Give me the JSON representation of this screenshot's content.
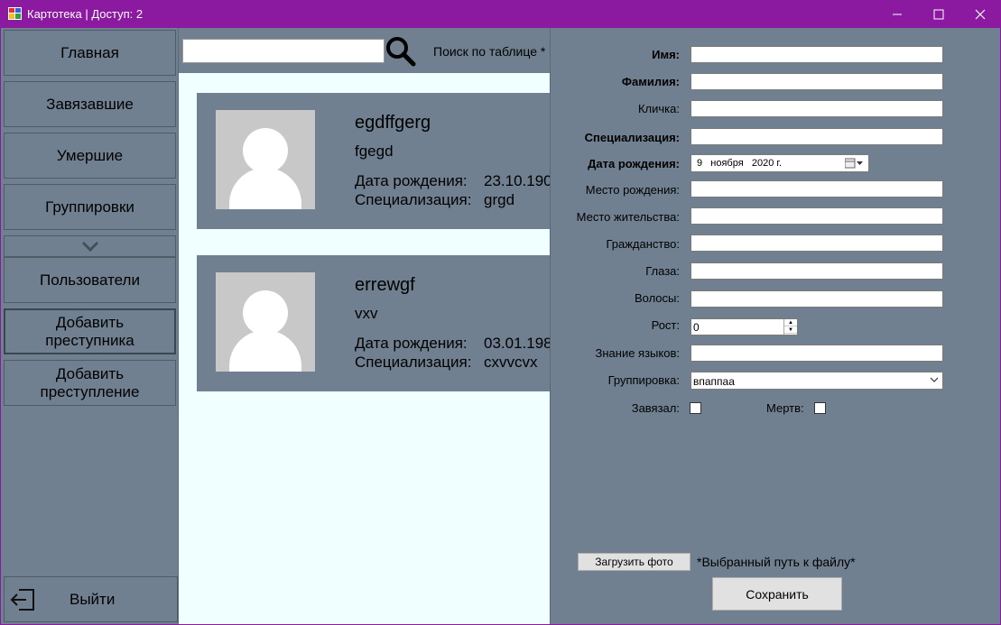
{
  "window": {
    "title": "Картотека | Доступ: 2",
    "icons": [
      "app-icon",
      "minimize-icon",
      "maximize-icon",
      "close-icon"
    ]
  },
  "sidebar": {
    "items": [
      {
        "label": "Главная"
      },
      {
        "label": "Завязавшие"
      },
      {
        "label": "Умершие"
      },
      {
        "label": "Группировки"
      },
      {
        "label": "Пользователи"
      },
      {
        "label": "Добавить\nпреступника"
      },
      {
        "label": "Добавить\nпреступление"
      }
    ],
    "exit_label": "Выйти"
  },
  "search": {
    "value": "",
    "hint": "Поиск по таблице *"
  },
  "cards": [
    {
      "name": "egdffgerg",
      "nickname": "fgegd",
      "birth_label": "Дата рождения:",
      "birth_value": "23.10.190",
      "spec_label": "Специализация:",
      "spec_value": "grgd"
    },
    {
      "name": "errewgf",
      "nickname": "vxv",
      "birth_label": "Дата рождения:",
      "birth_value": "03.01.198",
      "spec_label": "Специализация:",
      "spec_value": "cxvvcvx"
    }
  ],
  "form": {
    "fields": [
      {
        "label": "Имя:",
        "value": ""
      },
      {
        "label": "Фамилия:",
        "value": ""
      },
      {
        "label": "Кличка:",
        "value": ""
      },
      {
        "label": "Специализация:",
        "value": ""
      },
      {
        "label": "Дата рождения:",
        "value": "9   ноября   2020 г."
      },
      {
        "label": "Место рождения:",
        "value": ""
      },
      {
        "label": "Место жительства:",
        "value": ""
      },
      {
        "label": "Гражданство:",
        "value": ""
      },
      {
        "label": "Глаза:",
        "value": ""
      },
      {
        "label": "Волосы:",
        "value": ""
      },
      {
        "label": "Рост:",
        "value": "0"
      },
      {
        "label": "Знание языков:",
        "value": ""
      },
      {
        "label": "Группировка:",
        "value": "впаппаа"
      }
    ],
    "checkbox_left_label": "Завязал:",
    "checkbox_right_label": "Мертв:",
    "checkbox_left_checked": false,
    "checkbox_right_checked": false,
    "upload_button": "Загрузить фото",
    "path_text": "*Выбранный путь к файлу*",
    "save_button": "Сохранить"
  }
}
